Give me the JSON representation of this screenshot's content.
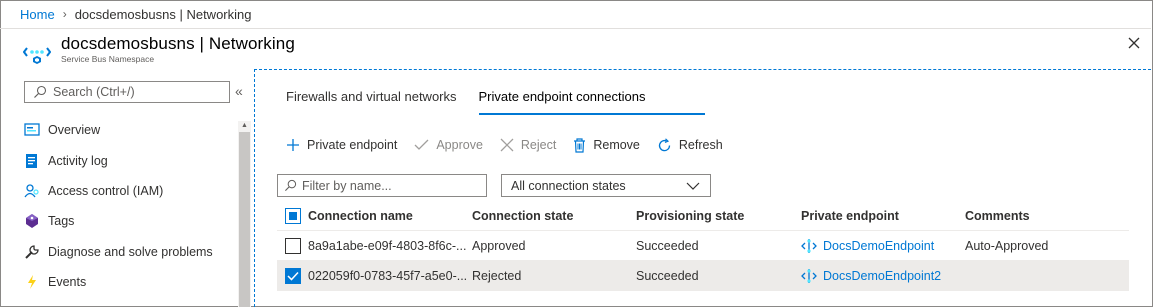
{
  "breadcrumb": {
    "home": "Home",
    "current": "docsdemosbusns | Networking"
  },
  "header": {
    "title": "docsdemosbusns | Networking",
    "subtitle": "Service Bus Namespace"
  },
  "sidebar": {
    "search_placeholder": "Search (Ctrl+/)",
    "items": [
      {
        "label": "Overview",
        "icon": "overview-icon"
      },
      {
        "label": "Activity log",
        "icon": "activity-log-icon"
      },
      {
        "label": "Access control (IAM)",
        "icon": "access-control-icon"
      },
      {
        "label": "Tags",
        "icon": "tag-icon"
      },
      {
        "label": "Diagnose and solve problems",
        "icon": "wrench-icon"
      },
      {
        "label": "Events",
        "icon": "lightning-icon"
      }
    ]
  },
  "tabs": [
    {
      "label": "Firewalls and virtual networks",
      "active": false
    },
    {
      "label": "Private endpoint connections",
      "active": true
    }
  ],
  "toolbar": {
    "add_label": "Private endpoint",
    "approve_label": "Approve",
    "reject_label": "Reject",
    "remove_label": "Remove",
    "refresh_label": "Refresh"
  },
  "filter": {
    "placeholder": "Filter by name...",
    "states_value": "All connection states"
  },
  "table": {
    "columns": [
      "Connection name",
      "Connection state",
      "Provisioning state",
      "Private endpoint",
      "Comments"
    ],
    "rows": [
      {
        "name": "8a9a1abe-e09f-4803-8f6c-...",
        "state": "Approved",
        "provisioning": "Succeeded",
        "endpoint": "DocsDemoEndpoint",
        "comments": "Auto-Approved",
        "checked": false
      },
      {
        "name": "022059f0-0783-45f7-a5e0-...",
        "state": "Rejected",
        "provisioning": "Succeeded",
        "endpoint": "DocsDemoEndpoint2",
        "comments": "",
        "checked": true
      }
    ]
  },
  "colors": {
    "accent": "#0078d4",
    "border": "#8a8886",
    "selected_row": "#edebe9"
  }
}
